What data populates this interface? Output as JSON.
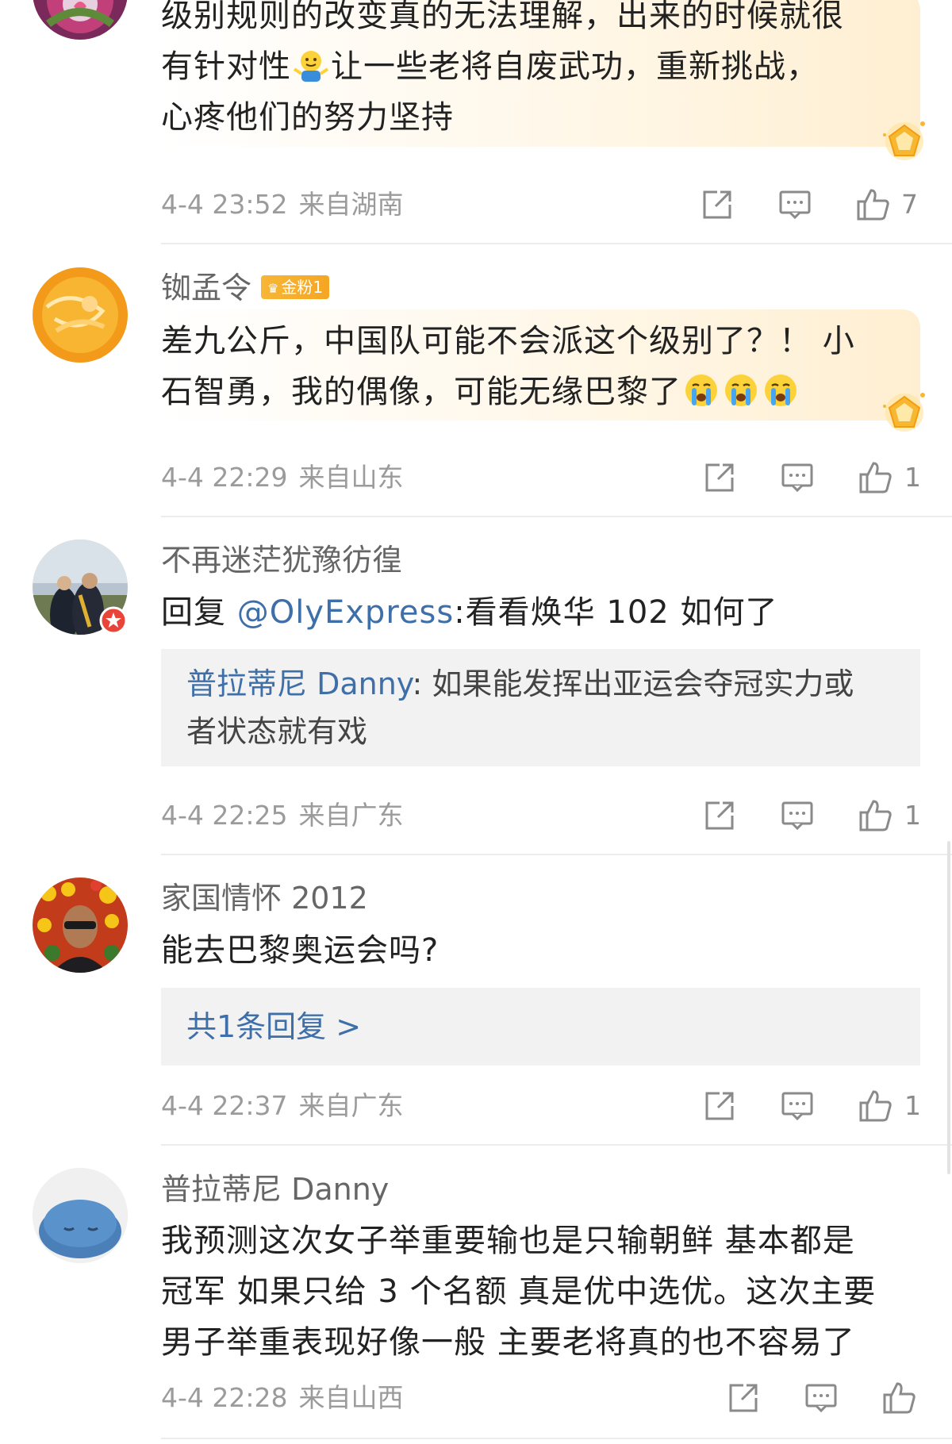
{
  "comments": [
    {
      "avatar": "purple-flower-avatar",
      "text_lines": [
        "级别规则的改变真的无法理解，出来的时候就很",
        "针对性",
        "让一些老将自废武功，重新挑战，",
        "心疼他们的努力坚持"
      ],
      "text_line1": "级别规则的改变真的无法理解，出来的时候就很",
      "text_line2a": "有针对性",
      "text_line2b": "让一些老将自废武功，重新挑战，",
      "text_line3": "心疼他们的努力坚持",
      "time": "4-4 23:52",
      "location": "来自湖南",
      "likes": "7"
    },
    {
      "username": "铷孟令",
      "badge": "金粉1",
      "text_line1": "差九公斤，中国队可能不会派这个级别了？！ 小",
      "text_line2": "石智勇，我的偶像，可能无缘巴黎了",
      "time": "4-4 22:29",
      "location": "来自山东",
      "likes": "1"
    },
    {
      "username": "不再迷茫犹豫彷徨",
      "reply_prefix": "回复 ",
      "mention": "@OlyExpress",
      "reply_text": ":看看焕华 102 如何了",
      "quoted_name": "普拉蒂尼 Danny",
      "quoted_text_line1": ": 如果能发挥出亚运会夺冠实力或",
      "quoted_text_line2": "者状态就有戏",
      "time": "4-4 22:25",
      "location": "来自广东",
      "likes": "1"
    },
    {
      "username": "家国情怀 2012",
      "text": "能去巴黎奥运会吗?",
      "replies_link": "共1条回复 >",
      "time": "4-4 22:37",
      "location": "来自广东",
      "likes": "1"
    },
    {
      "username": "普拉蒂尼 Danny",
      "text_line1": "我预测这次女子举重要输也是只输朝鲜 基本都是",
      "text_line2": "冠军 如果只给 3 个名额 真是优中选优。这次主要",
      "text_line3": "男子举重表现好像一般 主要老将真的也不容易了",
      "time": "4-4 22:28",
      "location": "来自山西",
      "likes": ""
    }
  ],
  "icons": {
    "share": "share-icon",
    "comment": "comment-icon",
    "like": "thumbs-up-icon",
    "fan_gem": "gold-fan-gem-icon",
    "emoji_shrug": "shrug-emoji-icon",
    "emoji_cry": "crying-emoji-icon"
  },
  "colors": {
    "link": "#3e6fa8",
    "meta": "#9b9b9b",
    "badge": "#f5a623",
    "reply_bg": "#f2f2f2"
  }
}
